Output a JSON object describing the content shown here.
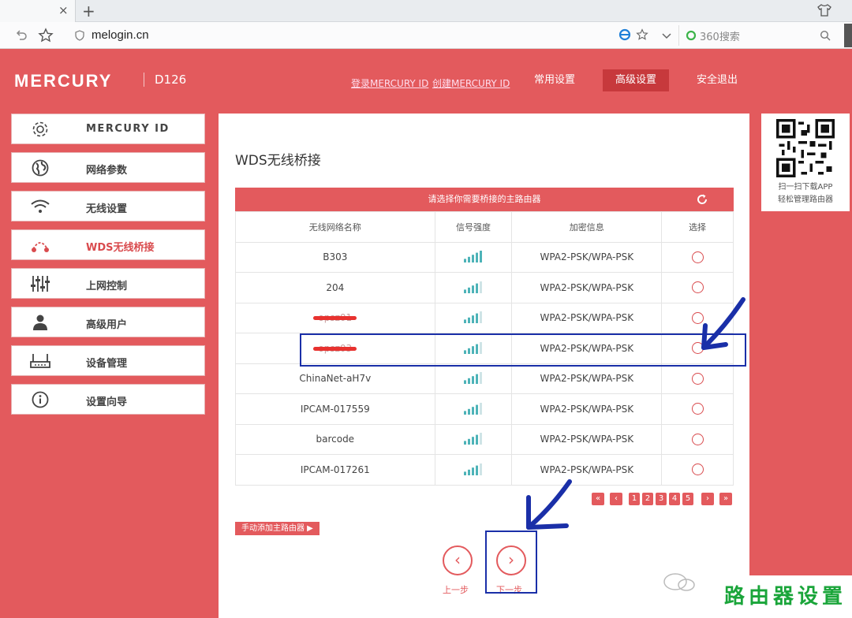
{
  "browser": {
    "tab_close": "×",
    "new_tab": "+",
    "url": "melogin.cn",
    "search_placeholder": "360搜索"
  },
  "header": {
    "brand": "MERCURY",
    "model": "D126",
    "login_link": "登录MERCURY ID",
    "create_link": "创建MERCURY ID",
    "nav": [
      "常用设置",
      "高级设置",
      "安全退出"
    ],
    "active_nav": "高级设置"
  },
  "sidebar": {
    "items": [
      {
        "label": "MERCURY ID",
        "icon": "gear-icon"
      },
      {
        "label": "网络参数",
        "icon": "globe-icon"
      },
      {
        "label": "无线设置",
        "icon": "wifi-icon"
      },
      {
        "label": "WDS无线桥接",
        "icon": "bridge-icon"
      },
      {
        "label": "上网控制",
        "icon": "sliders-icon"
      },
      {
        "label": "高级用户",
        "icon": "user-icon"
      },
      {
        "label": "设备管理",
        "icon": "router-icon"
      },
      {
        "label": "设置向导",
        "icon": "info-icon"
      }
    ],
    "active_index": 3
  },
  "main": {
    "title": "WDS无线桥接",
    "banner": "请选择你需要桥接的主路由器",
    "columns": [
      "无线网络名称",
      "信号强度",
      "加密信息",
      "选择"
    ],
    "rows": [
      {
        "ssid": "B303",
        "security": "WPA2-PSK/WPA-PSK",
        "signal": 5
      },
      {
        "ssid": "204",
        "security": "WPA2-PSK/WPA-PSK",
        "signal": 4
      },
      {
        "ssid": "opsz01",
        "security": "WPA2-PSK/WPA-PSK",
        "signal": 4
      },
      {
        "ssid": "opsz03",
        "security": "WPA2-PSK/WPA-PSK",
        "signal": 4
      },
      {
        "ssid": "ChinaNet-aH7v",
        "security": "WPA2-PSK/WPA-PSK",
        "signal": 4
      },
      {
        "ssid": "IPCAM-017559",
        "security": "WPA2-PSK/WPA-PSK",
        "signal": 4
      },
      {
        "ssid": "barcode",
        "security": "WPA2-PSK/WPA-PSK",
        "signal": 4
      },
      {
        "ssid": "IPCAM-017261",
        "security": "WPA2-PSK/WPA-PSK",
        "signal": 4
      }
    ],
    "pager": [
      "1",
      "2",
      "3",
      "4",
      "5"
    ],
    "manual_add": "手动添加主路由器 ▶",
    "prev_label": "上一步",
    "next_label": "下一步"
  },
  "qr": {
    "line1": "扫一扫下载APP",
    "line2": "轻松管理路由器"
  },
  "watermark": "路由器设置",
  "colors": {
    "brand_red": "#e35a5d",
    "active_red": "#c7393c",
    "annotation_blue": "#1a2fa8",
    "watermark_green": "#1aa53a"
  }
}
